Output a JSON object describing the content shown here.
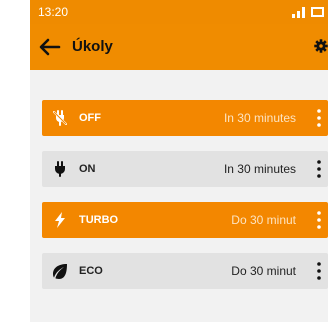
{
  "status_bar": {
    "time": "13:20"
  },
  "toolbar": {
    "title": "Úkoly"
  },
  "tasks": [
    {
      "name": "OFF",
      "time": "In 30 minutes",
      "icon": "plug-off-icon",
      "active": true
    },
    {
      "name": "ON",
      "time": "In 30 minutes",
      "icon": "plug-icon",
      "active": false
    },
    {
      "name": "TURBO",
      "time": "Do 30 minut",
      "icon": "bolt-icon",
      "active": true
    },
    {
      "name": "ECO",
      "time": "Do 30 minut",
      "icon": "leaf-icon",
      "active": false
    }
  ],
  "colors": {
    "accent": "#f08c00",
    "row_inactive": "#e2e2e2",
    "background": "#f2f2f2"
  }
}
